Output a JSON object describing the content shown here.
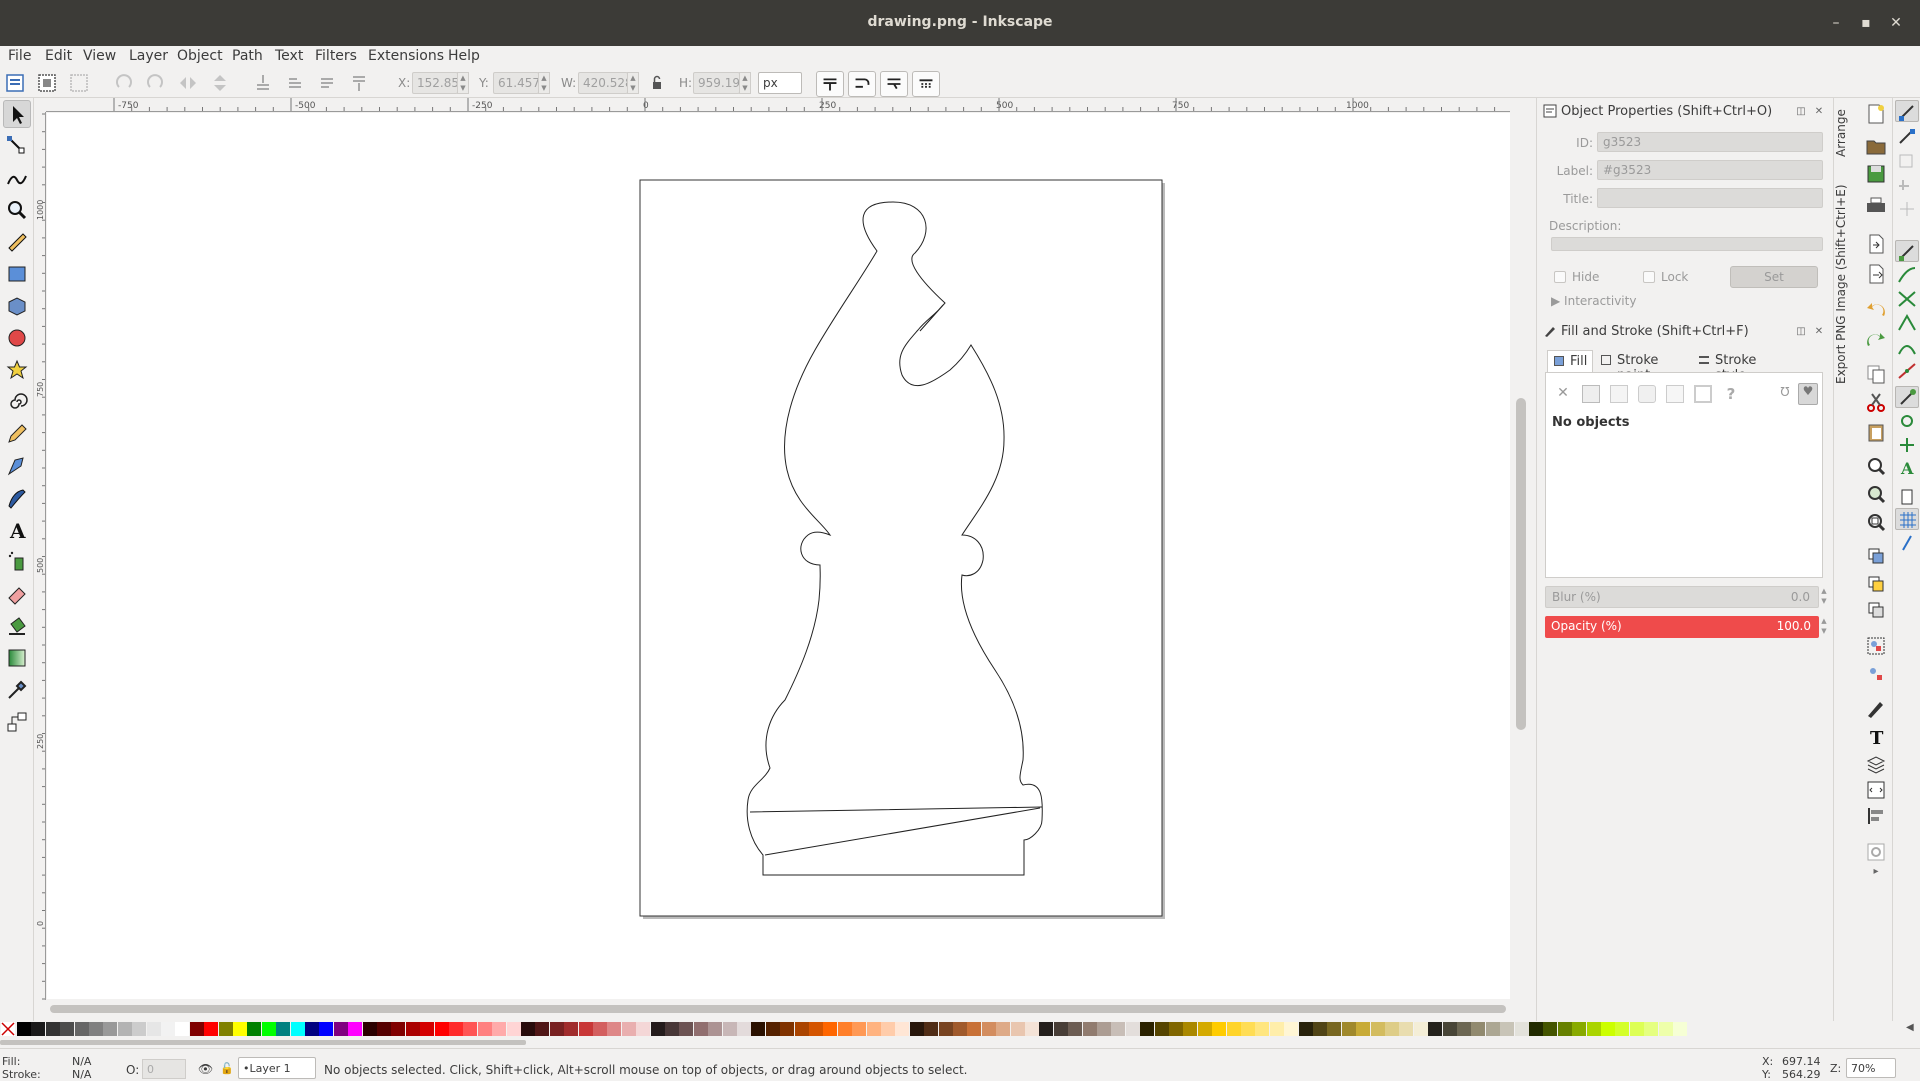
{
  "window": {
    "title": "drawing.png - Inkscape",
    "minimize": "–",
    "maximize": "▪",
    "close": "✕"
  },
  "menu": [
    "File",
    "Edit",
    "View",
    "Layer",
    "Object",
    "Path",
    "Text",
    "Filters",
    "Extensions",
    "Help"
  ],
  "tool_controls": {
    "x_label": "X:",
    "x_value": "152.859",
    "y_label": "Y:",
    "y_value": "61.457",
    "w_label": "W:",
    "w_value": "420.528",
    "h_label": "H:",
    "h_value": "959.193",
    "unit": "px"
  },
  "ruler": {
    "top_labels": [
      "-750",
      "-500",
      "-250",
      "0",
      "250",
      "500",
      "750",
      "1000"
    ],
    "left_labels": [
      "1000",
      "750",
      "500",
      "250",
      "0"
    ]
  },
  "object_properties": {
    "title": "Object Properties (Shift+Ctrl+O)",
    "id_label": "ID:",
    "id_value": "g3523",
    "label_label": "Label:",
    "label_value": "#g3523",
    "title_label": "Title:",
    "title_value": "",
    "description_label": "Description:",
    "hide_label": "Hide",
    "lock_label": "Lock",
    "set_button": "Set",
    "interactivity": "▶ Interactivity"
  },
  "fill_stroke": {
    "title": "Fill and Stroke (Shift+Ctrl+F)",
    "tabs": [
      "Fill",
      "Stroke paint",
      "Stroke style"
    ],
    "no_objects": "No objects",
    "blur_label": "Blur (%)",
    "blur_value": "0.0",
    "opacity_label": "Opacity (%)",
    "opacity_value": "100.0"
  },
  "vertical_tabs": [
    "Arrange",
    "Export PNG Image (Shift+Ctrl+E)"
  ],
  "status": {
    "fill_label": "Fill:",
    "fill_value": "N/A",
    "stroke_label": "Stroke:",
    "stroke_value": "N/A",
    "opacity_label": "O:",
    "opacity_value": "0",
    "layer": "•Layer 1",
    "message": "No objects selected. Click, Shift+click, Alt+scroll mouse on top of objects, or drag around objects to select.",
    "x_label": "X:",
    "x_value": "697.14",
    "y_label": "Y:",
    "y_value": "564.29",
    "zoom_label": "Z:",
    "zoom_value": "70%"
  },
  "colors": {
    "opacity_bar": "#ef4b4b",
    "palette": [
      "#000000",
      "#1a1a1a",
      "#333333",
      "#4d4d4d",
      "#666666",
      "#808080",
      "#999999",
      "#b3b3b3",
      "#cccccc",
      "#e6e6e6",
      "#f2f2f2",
      "#ffffff",
      "#800000",
      "#ff0000",
      "#808000",
      "#ffff00",
      "#008000",
      "#00ff00",
      "#008080",
      "#00ffff",
      "#000080",
      "#0000ff",
      "#800080",
      "#ff00ff",
      "#2b0000",
      "#550000",
      "#800000",
      "#aa0000",
      "#d40000",
      "#ff0000",
      "#ff2a2a",
      "#ff5555",
      "#ff8080",
      "#ffaaaa",
      "#ffd5d5",
      "#280b0b",
      "#501616",
      "#782121",
      "#a02c2c",
      "#c83737",
      "#d35f5f",
      "#de8787",
      "#e9afaf",
      "#f4d7d7",
      "#241c1c",
      "#483737",
      "#6c5353",
      "#916f6f",
      "#ac9393",
      "#c8b7b7",
      "#e3dbdb",
      "#2b1100",
      "#552200",
      "#803300",
      "#aa4400",
      "#d45500",
      "#ff6600",
      "#ff7f2a",
      "#ff9955",
      "#ffb380",
      "#ffccaa",
      "#ffe6d5",
      "#28170b",
      "#502d16",
      "#784421",
      "#a05a2c",
      "#c87137",
      "#d38d5f",
      "#deaa87",
      "#e9c6af",
      "#f4e3d7",
      "#241f1c",
      "#483e37",
      "#6c5d53",
      "#917c6f",
      "#ac9d93",
      "#c8beb7",
      "#e3dedb",
      "#2b2200",
      "#554400",
      "#806600",
      "#aa8800",
      "#d4aa00",
      "#ffcc00",
      "#ffd42a",
      "#ffdd55",
      "#ffe680",
      "#ffeeaa",
      "#fff6d5",
      "#28220b",
      "#504416",
      "#786721",
      "#a0892c",
      "#c8ab37",
      "#d3bc5f",
      "#decd87",
      "#e9ddaf",
      "#f4eed7",
      "#24221c",
      "#484537",
      "#6c6753",
      "#918a6f",
      "#aca793",
      "#c8c4b7",
      "#e3e2db",
      "#222b00",
      "#445500",
      "#668000",
      "#88aa00",
      "#aad400",
      "#ccff00",
      "#d4ff2a",
      "#ddff55",
      "#e5ff80",
      "#eeffaa",
      "#f6ffd5"
    ]
  }
}
